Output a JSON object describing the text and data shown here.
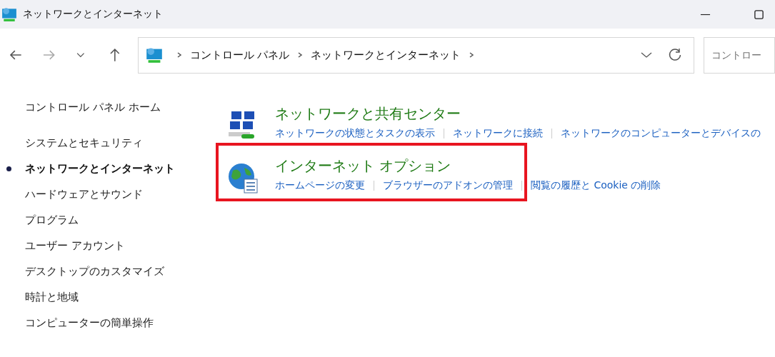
{
  "window": {
    "title": "ネットワークとインターネット"
  },
  "address_bar": {
    "crumbs": [
      "コントロール パネル",
      "ネットワークとインターネット"
    ]
  },
  "search": {
    "placeholder": "コントロー"
  },
  "sidebar": {
    "home": "コントロール パネル ホーム",
    "items": [
      {
        "label": "システムとセキュリティ",
        "selected": false
      },
      {
        "label": "ネットワークとインターネット",
        "selected": true
      },
      {
        "label": "ハードウェアとサウンド",
        "selected": false
      },
      {
        "label": "プログラム",
        "selected": false
      },
      {
        "label": "ユーザー アカウント",
        "selected": false
      },
      {
        "label": "デスクトップのカスタマイズ",
        "selected": false
      },
      {
        "label": "時計と地域",
        "selected": false
      },
      {
        "label": "コンピューターの簡単操作",
        "selected": false
      }
    ]
  },
  "sections": [
    {
      "kind": "network",
      "title": "ネットワークと共有センター",
      "links": [
        "ネットワークの状態とタスクの表示",
        "ネットワークに接続",
        "ネットワークのコンピューターとデバイスの"
      ],
      "highlighted": false
    },
    {
      "kind": "internet",
      "title": "インターネット オプション",
      "links": [
        "ホームページの変更",
        "ブラウザーのアドオンの管理",
        "閲覧の履歴と Cookie の削除"
      ],
      "highlighted": true
    }
  ]
}
